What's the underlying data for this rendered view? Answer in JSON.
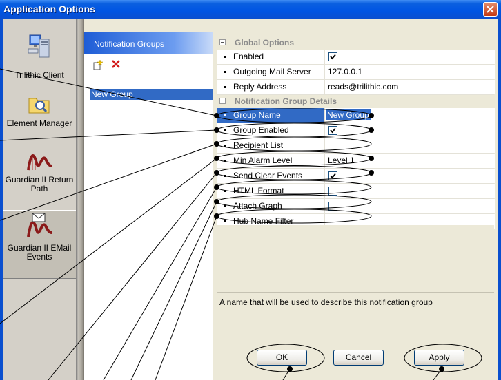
{
  "window": {
    "title": "Application Options"
  },
  "nav": [
    {
      "label": "Trilithic Client",
      "icon": "computer-icon"
    },
    {
      "label": "Element Manager",
      "icon": "folder-icon"
    },
    {
      "label": "Guardian II Return Path",
      "icon": "waveform-icon"
    },
    {
      "label": "Guardian II EMail Events",
      "icon": "waveform-mail-icon"
    }
  ],
  "groups": {
    "header": "Notification Groups",
    "items": [
      "New Group"
    ]
  },
  "properties": {
    "global": {
      "title": "Global Options",
      "rows": [
        {
          "name": "Enabled",
          "value": "",
          "checked": true
        },
        {
          "name": "Outgoing Mail Server",
          "value": "127.0.0.1"
        },
        {
          "name": "Reply Address",
          "value": "reads@trilithic.com"
        }
      ]
    },
    "details": {
      "title": "Notification Group Details",
      "rows": [
        {
          "name": "Group Name",
          "value": "New Group"
        },
        {
          "name": "Group Enabled",
          "value": "",
          "checked": true
        },
        {
          "name": "Recipient List",
          "value": ""
        },
        {
          "name": "Min Alarm Level",
          "value": "Level 1"
        },
        {
          "name": "Send Clear Events",
          "value": "",
          "checked": true
        },
        {
          "name": "HTML Format",
          "value": "",
          "checked": false
        },
        {
          "name": "Attach Graph",
          "value": "",
          "checked": false
        },
        {
          "name": "Hub Name Filter",
          "value": ""
        }
      ]
    }
  },
  "description": "A name that will be used to describe this notification group",
  "buttons": {
    "ok": "OK",
    "cancel": "Cancel",
    "apply": "Apply"
  },
  "colors": {
    "titlebar": "#0054e3",
    "selection": "#316ac5",
    "delete_icon": "#d21b1b"
  }
}
